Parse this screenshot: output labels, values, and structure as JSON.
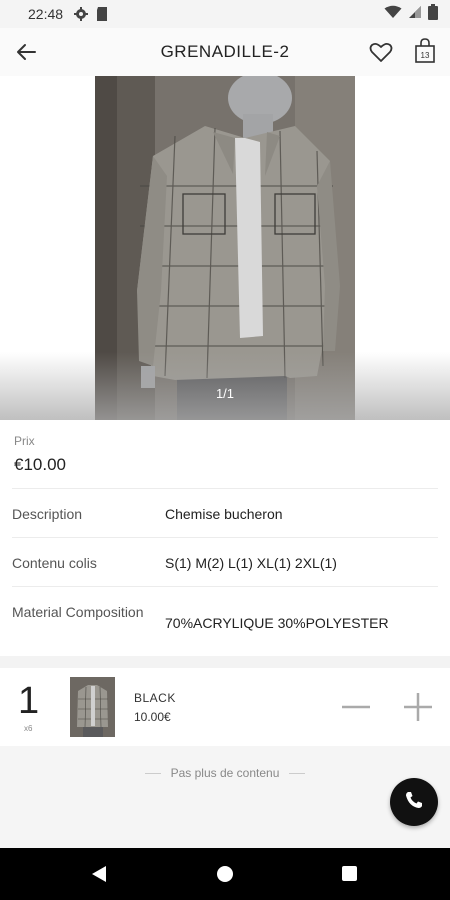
{
  "status_bar": {
    "time": "22:48",
    "icons": [
      "settings-icon",
      "sd-card-icon",
      "wifi-icon",
      "signal-icon",
      "battery-icon"
    ]
  },
  "app_bar": {
    "title": "GRENADILLE-2",
    "back_icon": "arrow-left-icon",
    "favorite_icon": "heart-icon",
    "cart_icon": "shopping-bag-icon",
    "cart_count": "13"
  },
  "gallery": {
    "counter": "1/1",
    "image_subject": "plaid flannel shirt on mannequin"
  },
  "price": {
    "label": "Prix",
    "value": "€10.00"
  },
  "attributes": [
    {
      "label": "Description",
      "value": "Chemise bucheron"
    },
    {
      "label": "Contenu colis",
      "value": "S(1) M(2) L(1) XL(1) 2XL(1)"
    },
    {
      "label": "Material Composition",
      "value": "70%ACRYLIQUE 30%POLYESTER"
    }
  ],
  "cart_line": {
    "quantity": "1",
    "quantity_sub": "x6",
    "variant": "BLACK",
    "unit_price": "10.00€"
  },
  "footer": {
    "end_text": "Pas plus de contenu",
    "call_icon": "phone-icon"
  },
  "colors": {
    "accent": "#111111",
    "app_bar_bg": "#fafafa",
    "footer_bg": "#f5f5f5"
  }
}
